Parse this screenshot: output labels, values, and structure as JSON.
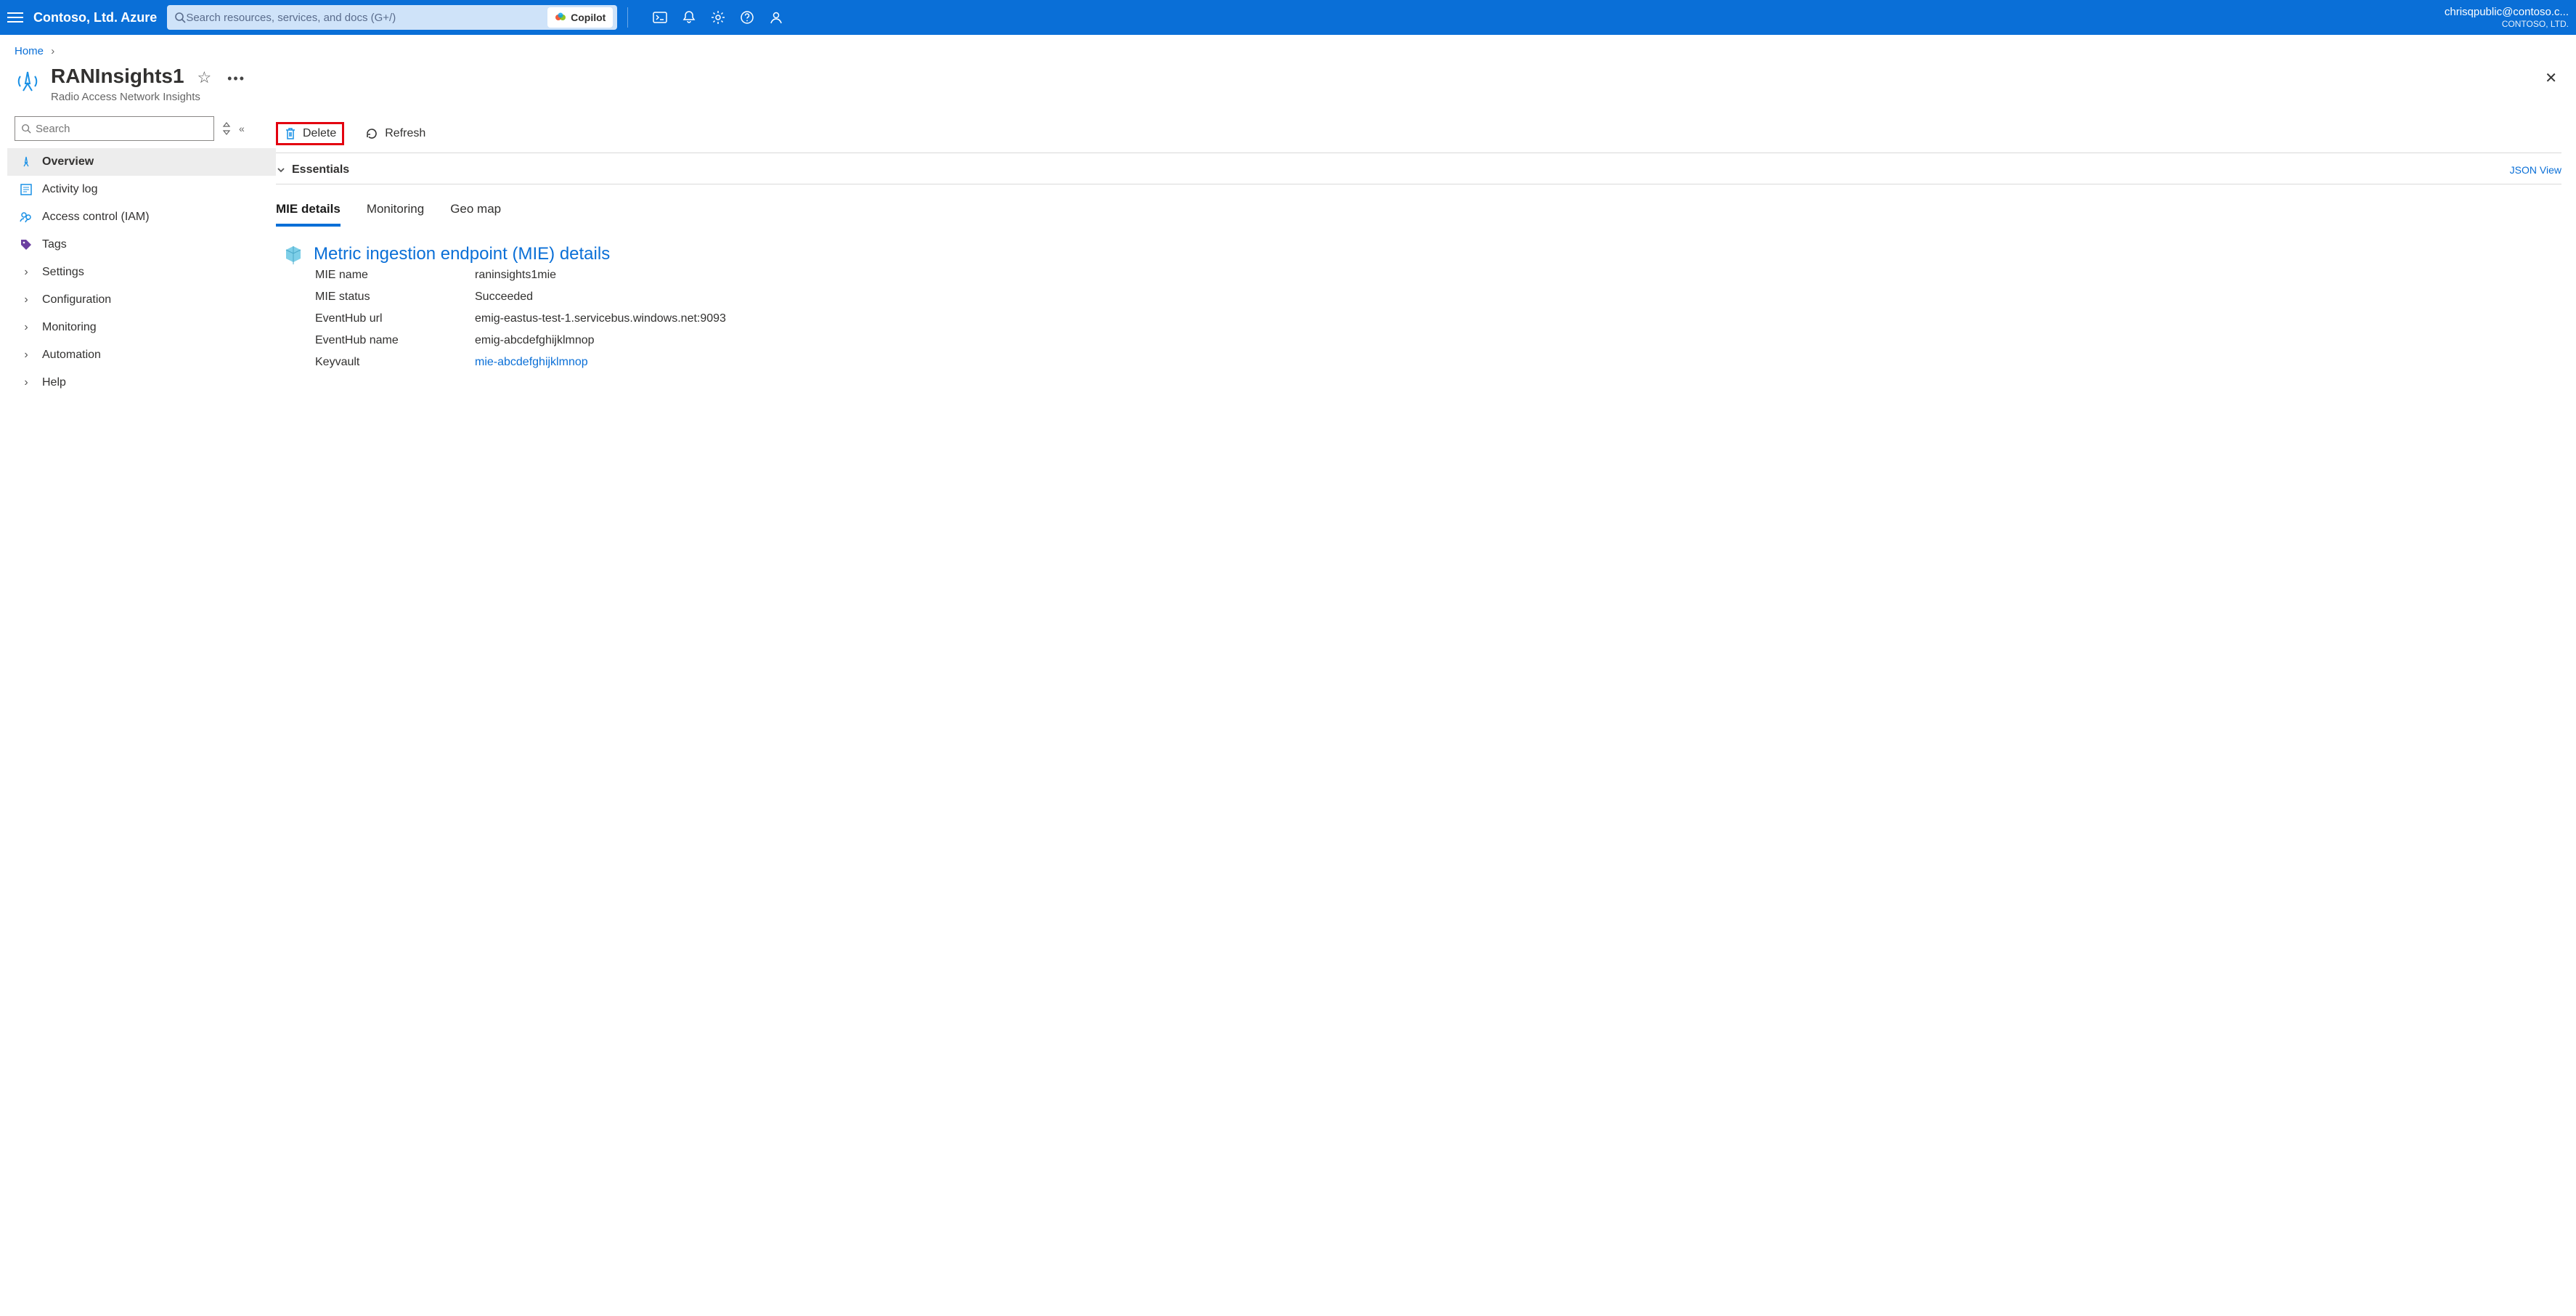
{
  "header": {
    "brand": "Contoso, Ltd. Azure",
    "search_placeholder": "Search resources, services, and docs (G+/)",
    "copilot_label": "Copilot",
    "user_email": "chrisqpublic@contoso.c...",
    "user_org": "CONTOSO, LTD."
  },
  "breadcrumb": {
    "home": "Home"
  },
  "resource": {
    "title": "RANInsights1",
    "subtitle": "Radio Access Network Insights"
  },
  "sidebar": {
    "search_placeholder": "Search",
    "items": [
      {
        "label": "Overview"
      },
      {
        "label": "Activity log"
      },
      {
        "label": "Access control (IAM)"
      },
      {
        "label": "Tags"
      },
      {
        "label": "Settings"
      },
      {
        "label": "Configuration"
      },
      {
        "label": "Monitoring"
      },
      {
        "label": "Automation"
      },
      {
        "label": "Help"
      }
    ]
  },
  "commandbar": {
    "delete": "Delete",
    "refresh": "Refresh"
  },
  "essentials": {
    "label": "Essentials",
    "json_view": "JSON View"
  },
  "tabs": [
    {
      "label": "MIE details"
    },
    {
      "label": "Monitoring"
    },
    {
      "label": "Geo map"
    }
  ],
  "mie": {
    "heading": "Metric ingestion endpoint (MIE) details",
    "rows": [
      {
        "k": "MIE name",
        "v": "raninsights1mie",
        "link": false
      },
      {
        "k": "MIE status",
        "v": "Succeeded",
        "link": false
      },
      {
        "k": "EventHub url",
        "v": "emig-eastus-test-1.servicebus.windows.net:9093",
        "link": false
      },
      {
        "k": "EventHub name",
        "v": "emig-abcdefghijklmnop",
        "link": false
      },
      {
        "k": "Keyvault",
        "v": "mie-abcdefghijklmnop",
        "link": true
      }
    ]
  }
}
